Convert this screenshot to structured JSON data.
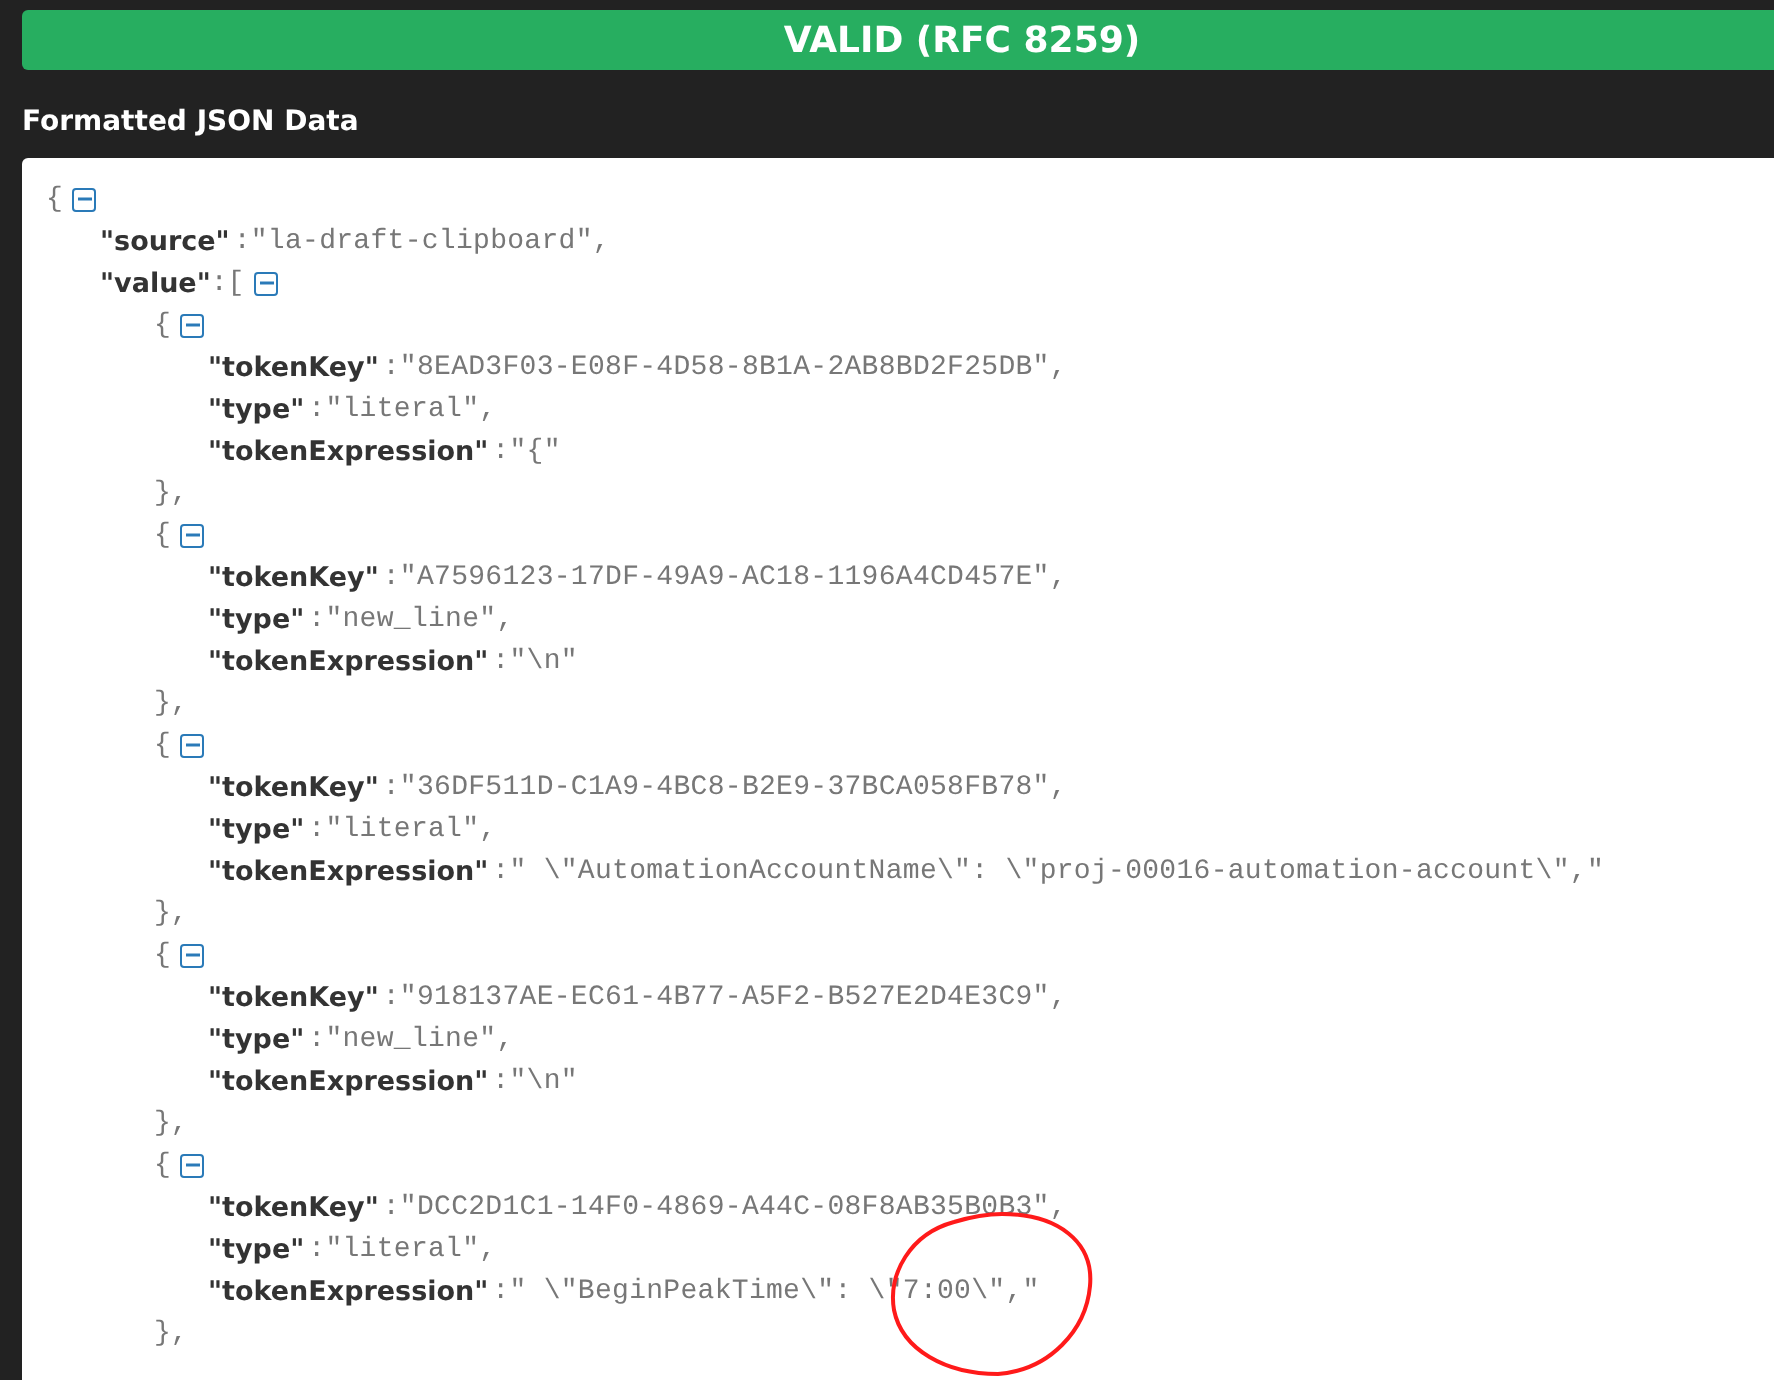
{
  "status_banner": {
    "text": "VALID (RFC 8259)",
    "valid": true
  },
  "section_title": "Formatted JSON Data",
  "json_tree": {
    "open": "{",
    "expanded": true,
    "children": [
      {
        "key": "\"source\"",
        "value": ":\"la-draft-clipboard\","
      },
      {
        "key": "\"value\"",
        "open": ":[",
        "expanded": true,
        "children": [
          {
            "open": "{",
            "expanded": true,
            "close": "},",
            "children": [
              {
                "key": "\"tokenKey\"",
                "value": ":\"8EAD3F03-E08F-4D58-8B1A-2AB8BD2F25DB\","
              },
              {
                "key": "\"type\"",
                "value": ":\"literal\","
              },
              {
                "key": "\"tokenExpression\"",
                "value": ":\"{\""
              }
            ]
          },
          {
            "open": "{",
            "expanded": true,
            "close": "},",
            "children": [
              {
                "key": "\"tokenKey\"",
                "value": ":\"A7596123-17DF-49A9-AC18-1196A4CD457E\","
              },
              {
                "key": "\"type\"",
                "value": ":\"new_line\","
              },
              {
                "key": "\"tokenExpression\"",
                "value": ":\"\\n\""
              }
            ]
          },
          {
            "open": "{",
            "expanded": true,
            "close": "},",
            "children": [
              {
                "key": "\"tokenKey\"",
                "value": ":\"36DF511D-C1A9-4BC8-B2E9-37BCA058FB78\","
              },
              {
                "key": "\"type\"",
                "value": ":\"literal\","
              },
              {
                "key": "\"tokenExpression\"",
                "value": ":\" \\\"AutomationAccountName\\\": \\\"proj-00016-automation-account\\\",\""
              }
            ]
          },
          {
            "open": "{",
            "expanded": true,
            "close": "},",
            "children": [
              {
                "key": "\"tokenKey\"",
                "value": ":\"918137AE-EC61-4B77-A5F2-B527E2D4E3C9\","
              },
              {
                "key": "\"type\"",
                "value": ":\"new_line\","
              },
              {
                "key": "\"tokenExpression\"",
                "value": ":\"\\n\""
              }
            ]
          },
          {
            "open": "{",
            "expanded": true,
            "close": "},",
            "children": [
              {
                "key": "\"tokenKey\"",
                "value": ":\"DCC2D1C1-14F0-4869-A44C-08F8AB35B0B3\","
              },
              {
                "key": "\"type\"",
                "value": ":\"literal\","
              },
              {
                "key": "\"tokenExpression\"",
                "value": ":\" \\\"BeginPeakTime\\\": \\\"7:00\\\",\""
              }
            ]
          }
        ]
      }
    ]
  }
}
